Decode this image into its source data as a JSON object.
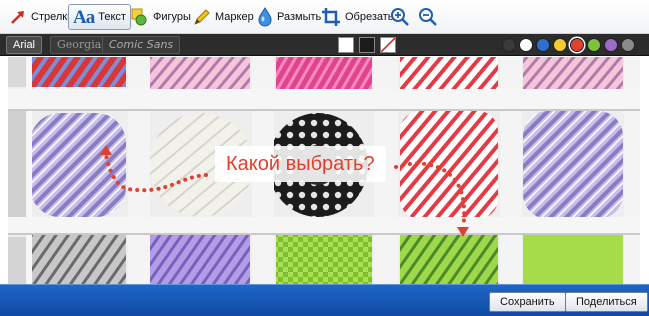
{
  "toolbar": {
    "items": [
      {
        "label": "Стрелки",
        "icon": "arrow-icon"
      },
      {
        "label": "Текст",
        "icon": "text-aa-icon",
        "icon_text": "Aa",
        "active": true
      },
      {
        "label": "Фигуры",
        "icon": "shapes-icon"
      },
      {
        "label": "Маркер",
        "icon": "marker-pen-icon"
      },
      {
        "label": "Размыть",
        "icon": "blur-drop-icon"
      },
      {
        "label": "Обрезать",
        "icon": "crop-icon"
      },
      {
        "label": "",
        "icon": "zoom-in-icon"
      },
      {
        "label": "",
        "icon": "zoom-out-icon"
      }
    ]
  },
  "formatbar": {
    "fonts": [
      {
        "label": "Arial",
        "active": true
      },
      {
        "label": "Georgia",
        "active": false
      },
      {
        "label": "Comic Sans",
        "active": false
      }
    ],
    "background_options": [
      "white",
      "dark",
      "none"
    ],
    "colors": [
      "#3a3a3a",
      "#ffffff",
      "#2f6fd0",
      "#f2cc2e",
      "#e0412f",
      "#7cc23a",
      "#9b6bc8",
      "#8a8a8a"
    ],
    "selected_color": "#e0412f"
  },
  "annotation": {
    "text": "Какой выбрать?",
    "color": "#e0412f"
  },
  "bottom": {
    "save_label": "Сохранить",
    "share_label": "Поделиться"
  }
}
